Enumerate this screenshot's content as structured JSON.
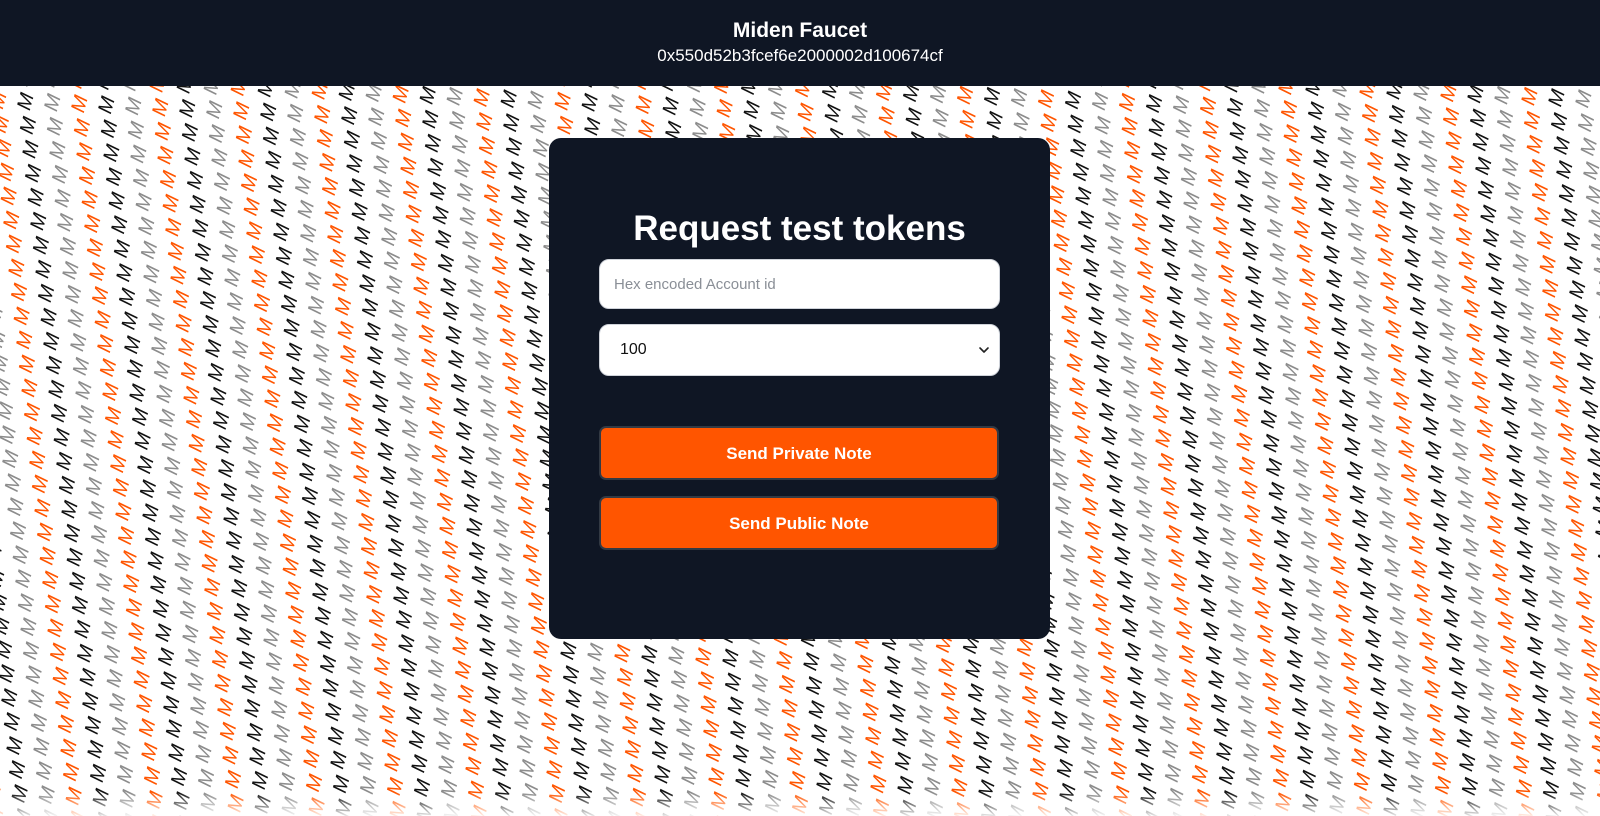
{
  "header": {
    "title": "Miden Faucet",
    "address": "0x550d52b3fcef6e2000002d100674cf"
  },
  "card": {
    "heading": "Request test tokens",
    "account_input": {
      "value": "",
      "placeholder": "Hex encoded Account id"
    },
    "amount_select": {
      "selected": "100"
    },
    "private_button_label": "Send Private Note",
    "public_button_label": "Send Public Note"
  },
  "background": {
    "glyph": "M",
    "colors": [
      "#ff5500",
      "#8c8c8c",
      "#111111"
    ]
  },
  "icons": {
    "amount_select_arrow": "chevron-down-icon"
  }
}
